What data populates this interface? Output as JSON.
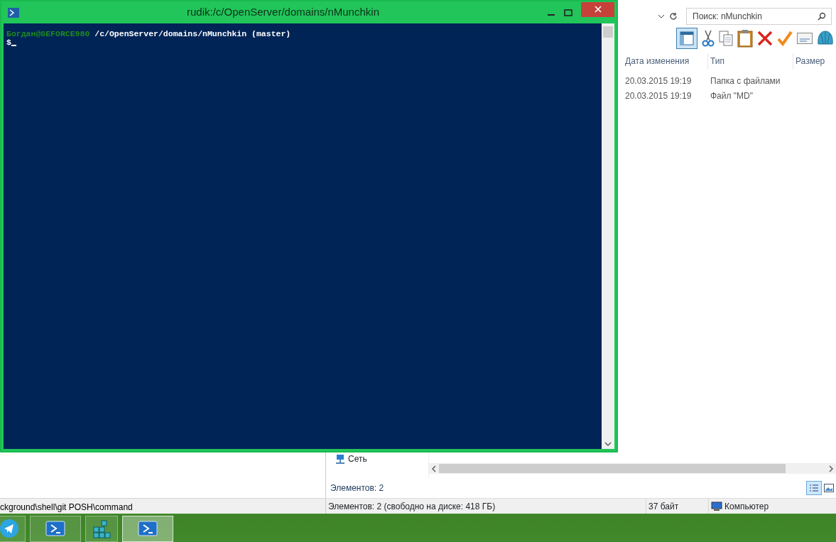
{
  "background_window": {
    "status_text": "ckground\\shell\\git POSH\\command"
  },
  "explorer": {
    "search": {
      "placeholder": "Поиск: nMunchkin"
    },
    "columns": [
      "Дата изменения",
      "Тип",
      "Размер"
    ],
    "rows": [
      {
        "date": "20.03.2015 19:19",
        "type": "Папка с файлами"
      },
      {
        "date": "20.03.2015 19:19",
        "type": "Файл \"MD\""
      }
    ],
    "nav_items": [
      "Сеть"
    ],
    "item_count": "Элементов: 2",
    "status_bar": [
      "Элементов: 2 (свободно на диске: 418 ГБ)",
      "37 байт",
      "Компьютер"
    ]
  },
  "console": {
    "title": "rudik:/c/OpenServer/domains/nMunchkin",
    "lines": [
      [
        {
          "kind": "user",
          "text": "Богдан@GEFORCE980"
        },
        {
          "kind": "path",
          "text": " /c/OpenServer/domains/nMunchkin (master)"
        }
      ],
      [
        {
          "kind": "prompt",
          "text": "$"
        }
      ]
    ]
  },
  "taskbar": [
    {
      "kind": "plane",
      "selected": false
    },
    {
      "kind": "terminal",
      "selected": false
    },
    {
      "kind": "cubes",
      "selected": false
    },
    {
      "kind": "terminal",
      "selected": true
    }
  ]
}
